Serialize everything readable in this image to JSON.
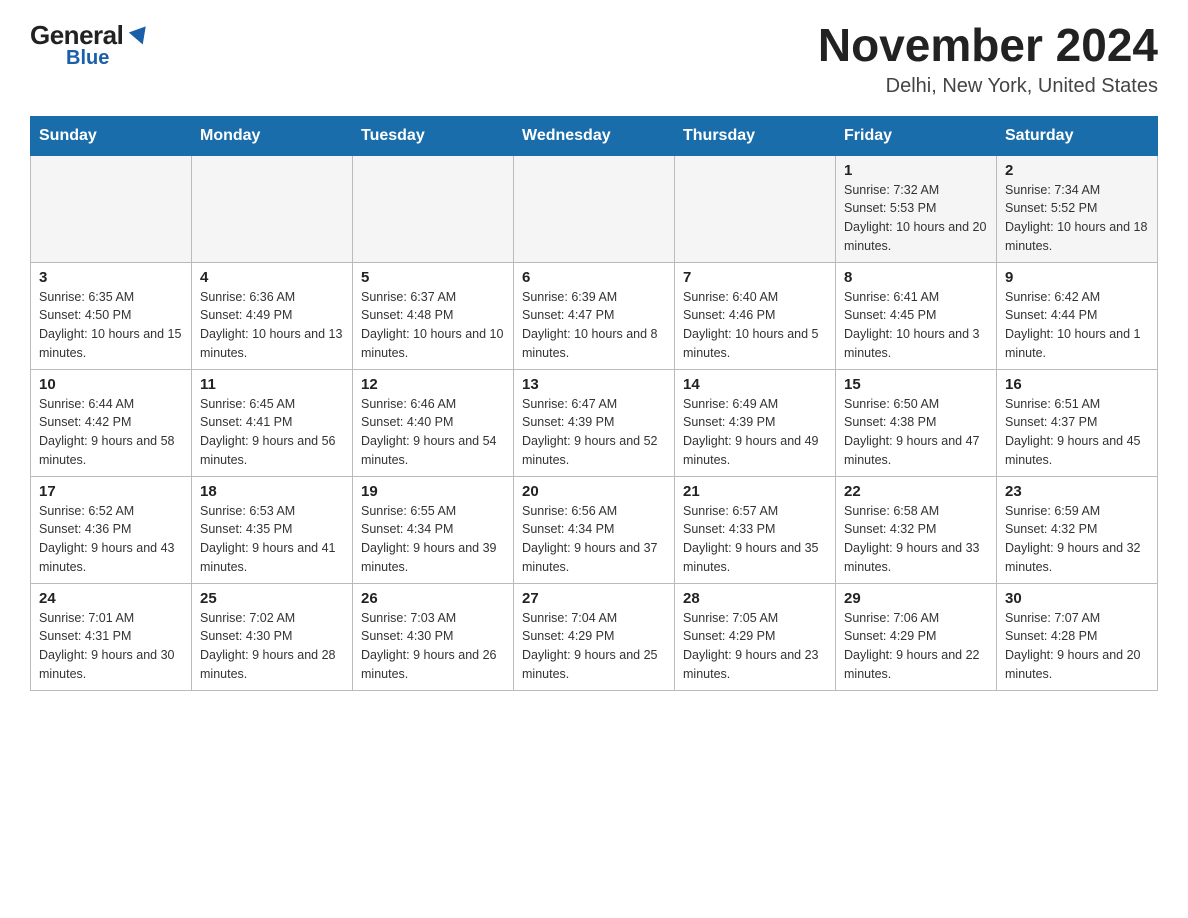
{
  "header": {
    "logo_general": "General",
    "logo_blue": "Blue",
    "title": "November 2024",
    "location": "Delhi, New York, United States"
  },
  "days_of_week": [
    "Sunday",
    "Monday",
    "Tuesday",
    "Wednesday",
    "Thursday",
    "Friday",
    "Saturday"
  ],
  "weeks": [
    [
      {
        "day": "",
        "info": ""
      },
      {
        "day": "",
        "info": ""
      },
      {
        "day": "",
        "info": ""
      },
      {
        "day": "",
        "info": ""
      },
      {
        "day": "",
        "info": ""
      },
      {
        "day": "1",
        "info": "Sunrise: 7:32 AM\nSunset: 5:53 PM\nDaylight: 10 hours and 20 minutes."
      },
      {
        "day": "2",
        "info": "Sunrise: 7:34 AM\nSunset: 5:52 PM\nDaylight: 10 hours and 18 minutes."
      }
    ],
    [
      {
        "day": "3",
        "info": "Sunrise: 6:35 AM\nSunset: 4:50 PM\nDaylight: 10 hours and 15 minutes."
      },
      {
        "day": "4",
        "info": "Sunrise: 6:36 AM\nSunset: 4:49 PM\nDaylight: 10 hours and 13 minutes."
      },
      {
        "day": "5",
        "info": "Sunrise: 6:37 AM\nSunset: 4:48 PM\nDaylight: 10 hours and 10 minutes."
      },
      {
        "day": "6",
        "info": "Sunrise: 6:39 AM\nSunset: 4:47 PM\nDaylight: 10 hours and 8 minutes."
      },
      {
        "day": "7",
        "info": "Sunrise: 6:40 AM\nSunset: 4:46 PM\nDaylight: 10 hours and 5 minutes."
      },
      {
        "day": "8",
        "info": "Sunrise: 6:41 AM\nSunset: 4:45 PM\nDaylight: 10 hours and 3 minutes."
      },
      {
        "day": "9",
        "info": "Sunrise: 6:42 AM\nSunset: 4:44 PM\nDaylight: 10 hours and 1 minute."
      }
    ],
    [
      {
        "day": "10",
        "info": "Sunrise: 6:44 AM\nSunset: 4:42 PM\nDaylight: 9 hours and 58 minutes."
      },
      {
        "day": "11",
        "info": "Sunrise: 6:45 AM\nSunset: 4:41 PM\nDaylight: 9 hours and 56 minutes."
      },
      {
        "day": "12",
        "info": "Sunrise: 6:46 AM\nSunset: 4:40 PM\nDaylight: 9 hours and 54 minutes."
      },
      {
        "day": "13",
        "info": "Sunrise: 6:47 AM\nSunset: 4:39 PM\nDaylight: 9 hours and 52 minutes."
      },
      {
        "day": "14",
        "info": "Sunrise: 6:49 AM\nSunset: 4:39 PM\nDaylight: 9 hours and 49 minutes."
      },
      {
        "day": "15",
        "info": "Sunrise: 6:50 AM\nSunset: 4:38 PM\nDaylight: 9 hours and 47 minutes."
      },
      {
        "day": "16",
        "info": "Sunrise: 6:51 AM\nSunset: 4:37 PM\nDaylight: 9 hours and 45 minutes."
      }
    ],
    [
      {
        "day": "17",
        "info": "Sunrise: 6:52 AM\nSunset: 4:36 PM\nDaylight: 9 hours and 43 minutes."
      },
      {
        "day": "18",
        "info": "Sunrise: 6:53 AM\nSunset: 4:35 PM\nDaylight: 9 hours and 41 minutes."
      },
      {
        "day": "19",
        "info": "Sunrise: 6:55 AM\nSunset: 4:34 PM\nDaylight: 9 hours and 39 minutes."
      },
      {
        "day": "20",
        "info": "Sunrise: 6:56 AM\nSunset: 4:34 PM\nDaylight: 9 hours and 37 minutes."
      },
      {
        "day": "21",
        "info": "Sunrise: 6:57 AM\nSunset: 4:33 PM\nDaylight: 9 hours and 35 minutes."
      },
      {
        "day": "22",
        "info": "Sunrise: 6:58 AM\nSunset: 4:32 PM\nDaylight: 9 hours and 33 minutes."
      },
      {
        "day": "23",
        "info": "Sunrise: 6:59 AM\nSunset: 4:32 PM\nDaylight: 9 hours and 32 minutes."
      }
    ],
    [
      {
        "day": "24",
        "info": "Sunrise: 7:01 AM\nSunset: 4:31 PM\nDaylight: 9 hours and 30 minutes."
      },
      {
        "day": "25",
        "info": "Sunrise: 7:02 AM\nSunset: 4:30 PM\nDaylight: 9 hours and 28 minutes."
      },
      {
        "day": "26",
        "info": "Sunrise: 7:03 AM\nSunset: 4:30 PM\nDaylight: 9 hours and 26 minutes."
      },
      {
        "day": "27",
        "info": "Sunrise: 7:04 AM\nSunset: 4:29 PM\nDaylight: 9 hours and 25 minutes."
      },
      {
        "day": "28",
        "info": "Sunrise: 7:05 AM\nSunset: 4:29 PM\nDaylight: 9 hours and 23 minutes."
      },
      {
        "day": "29",
        "info": "Sunrise: 7:06 AM\nSunset: 4:29 PM\nDaylight: 9 hours and 22 minutes."
      },
      {
        "day": "30",
        "info": "Sunrise: 7:07 AM\nSunset: 4:28 PM\nDaylight: 9 hours and 20 minutes."
      }
    ]
  ]
}
